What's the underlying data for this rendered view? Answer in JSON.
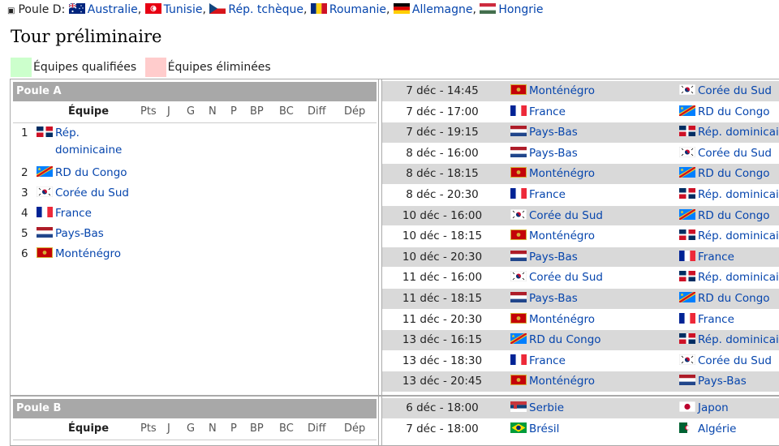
{
  "top": {
    "prefix": "Poule D:",
    "teams": [
      {
        "name": "Australie",
        "flag": "au-flag"
      },
      {
        "name": "Tunisie",
        "flag": "tn-flag"
      },
      {
        "name": "Rép. tchèque",
        "flag": "cz-flag"
      },
      {
        "name": "Roumanie",
        "flag": "ro-flag"
      },
      {
        "name": "Allemagne",
        "flag": "de-flag"
      },
      {
        "name": "Hongrie",
        "flag": "hu-flag"
      }
    ]
  },
  "title": "Tour préliminaire",
  "legend": {
    "qualified": "Équipes qualifiées",
    "eliminated": "Équipes éliminées",
    "qualified_color": "#ccffcc",
    "eliminated_color": "#ffcccc"
  },
  "columns": [
    "Équipe",
    "Pts",
    "J",
    "G",
    "N",
    "P",
    "BP",
    "BC",
    "Diff",
    "Dép"
  ],
  "poolA": {
    "name": "Poule A",
    "standings": [
      {
        "rank": "1",
        "team": "Rép. dominicaine",
        "flag": "do-flag"
      },
      {
        "rank": "2",
        "team": "RD du Congo",
        "flag": "cd-flag"
      },
      {
        "rank": "3",
        "team": "Corée du Sud",
        "flag": "kr-flag"
      },
      {
        "rank": "4",
        "team": "France",
        "flag": "fr-flag"
      },
      {
        "rank": "5",
        "team": "Pays-Bas",
        "flag": "nl-flag"
      },
      {
        "rank": "6",
        "team": "Monténégro",
        "flag": "me-flag"
      }
    ],
    "matches": [
      {
        "date": "7 déc - 14:45",
        "home": "Monténégro",
        "hf": "me",
        "away": "Corée du Sud",
        "af": "kr"
      },
      {
        "date": "7 déc - 17:00",
        "home": "France",
        "hf": "fr",
        "away": "RD du Congo",
        "af": "cd"
      },
      {
        "date": "7 déc - 19:15",
        "home": "Pays-Bas",
        "hf": "nl",
        "away": "Rép. dominicaine",
        "af": "do"
      },
      {
        "date": "8 déc - 16:00",
        "home": "Pays-Bas",
        "hf": "nl",
        "away": "Corée du Sud",
        "af": "kr"
      },
      {
        "date": "8 déc - 18:15",
        "home": "Monténégro",
        "hf": "me",
        "away": "RD du Congo",
        "af": "cd"
      },
      {
        "date": "8 déc - 20:30",
        "home": "France",
        "hf": "fr",
        "away": "Rép. dominicaine",
        "af": "do"
      },
      {
        "date": "10 déc - 16:00",
        "home": "Corée du Sud",
        "hf": "kr",
        "away": "RD du Congo",
        "af": "cd"
      },
      {
        "date": "10 déc - 18:15",
        "home": "Monténégro",
        "hf": "me",
        "away": "Rép. dominicaine",
        "af": "do"
      },
      {
        "date": "10 déc - 20:30",
        "home": "Pays-Bas",
        "hf": "nl",
        "away": "France",
        "af": "fr"
      },
      {
        "date": "11 déc - 16:00",
        "home": "Corée du Sud",
        "hf": "kr",
        "away": "Rép. dominicaine",
        "af": "do"
      },
      {
        "date": "11 déc - 18:15",
        "home": "Pays-Bas",
        "hf": "nl",
        "away": "RD du Congo",
        "af": "cd"
      },
      {
        "date": "11 déc - 20:30",
        "home": "Monténégro",
        "hf": "me",
        "away": "France",
        "af": "fr"
      },
      {
        "date": "13 déc - 16:15",
        "home": "RD du Congo",
        "hf": "cd",
        "away": "Rép. dominicaine",
        "af": "do"
      },
      {
        "date": "13 déc - 18:30",
        "home": "France",
        "hf": "fr",
        "away": "Corée du Sud",
        "af": "kr"
      },
      {
        "date": "13 déc - 20:45",
        "home": "Monténégro",
        "hf": "me",
        "away": "Pays-Bas",
        "af": "nl"
      }
    ]
  },
  "poolB": {
    "name": "Poule B",
    "matches": [
      {
        "date": "6 déc - 18:00",
        "home": "Serbie",
        "hf": "rs",
        "away": "Japon",
        "af": "jp"
      },
      {
        "date": "7 déc - 18:00",
        "home": "Brésil",
        "hf": "br",
        "away": "Algérie",
        "af": "dz"
      }
    ]
  }
}
